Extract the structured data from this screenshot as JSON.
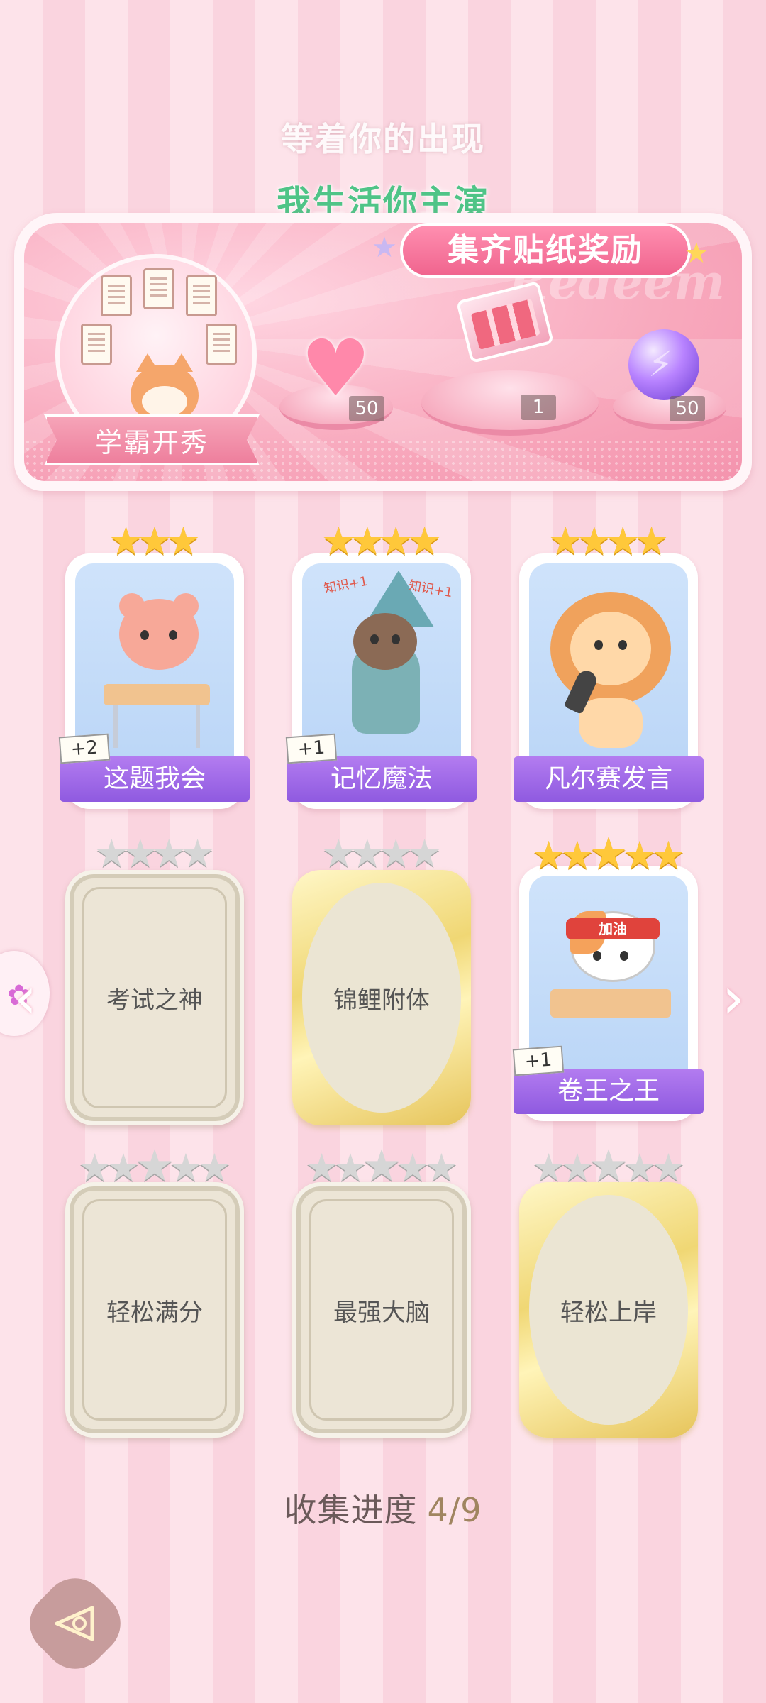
{
  "lyrics": {
    "line1": "等着你的出现",
    "line2": "我生活你主演"
  },
  "banner": {
    "title": "集齐贴纸奖励",
    "watermark": "Redeem",
    "sticker_name": "学霸开秀",
    "rewards": [
      {
        "icon": "pink-heart-gem-icon",
        "qty": "50"
      },
      {
        "icon": "gift-box-icon",
        "qty": "1"
      },
      {
        "icon": "lightning-orb-icon",
        "qty": "50"
      }
    ]
  },
  "stickers": [
    {
      "name": "这题我会",
      "stars": 3,
      "max_stars": 3,
      "collected": true,
      "bonus": "+2",
      "character": "bear-at-desk-icon"
    },
    {
      "name": "记忆魔法",
      "stars": 4,
      "max_stars": 4,
      "collected": true,
      "bonus": "+1",
      "character": "wizard-otter-icon",
      "extra_text": [
        "知识+1",
        "知识+1"
      ]
    },
    {
      "name": "凡尔赛发言",
      "stars": 4,
      "max_stars": 4,
      "collected": true,
      "bonus": "",
      "character": "singing-lion-icon"
    },
    {
      "name": "考试之神",
      "stars": 0,
      "max_stars": 4,
      "collected": false,
      "frame": "silver"
    },
    {
      "name": "锦鲤附体",
      "stars": 0,
      "max_stars": 4,
      "collected": false,
      "frame": "gold"
    },
    {
      "name": "卷王之王",
      "stars": 5,
      "max_stars": 5,
      "collected": true,
      "bonus": "+1",
      "character": "studying-cat-icon",
      "headband": "加油"
    },
    {
      "name": "轻松满分",
      "stars": 0,
      "max_stars": 5,
      "collected": false,
      "frame": "silver"
    },
    {
      "name": "最强大脑",
      "stars": 0,
      "max_stars": 5,
      "collected": false,
      "frame": "silver"
    },
    {
      "name": "轻松上岸",
      "stars": 0,
      "max_stars": 5,
      "collected": false,
      "frame": "gold"
    }
  ],
  "progress": {
    "label": "收集进度",
    "value": "4/9",
    "collected": 4,
    "total": 9
  },
  "nav": {
    "left_arrow": "‹",
    "right_arrow": "›",
    "back_icon": "back-triangle-icon"
  },
  "colors": {
    "accent_pink": "#f0648e",
    "label_purple": "#8f5ae0",
    "lyric_green": "#4fc487",
    "star_gold": "#ffc83a",
    "star_grey": "#d6d6d6"
  }
}
